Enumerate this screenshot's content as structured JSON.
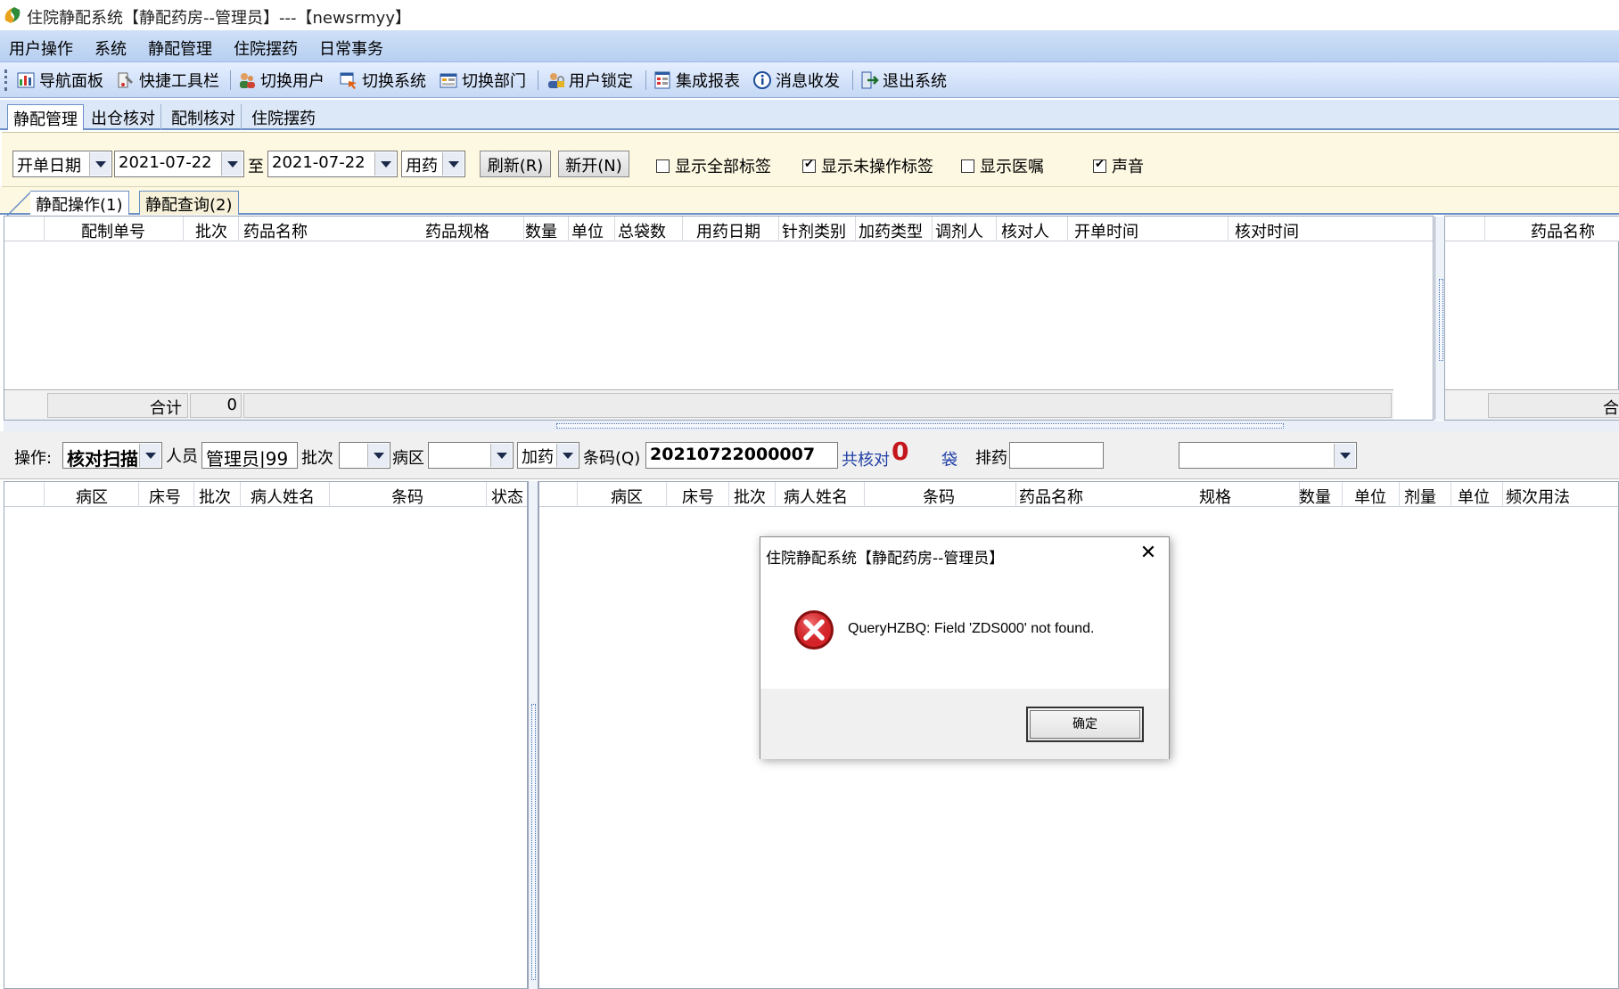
{
  "window": {
    "title": "住院静配系统【静配药房--管理员】---【newsrmyy】"
  },
  "menu": [
    "用户操作",
    "系统",
    "静配管理",
    "住院摆药",
    "日常事务"
  ],
  "toolbar": [
    {
      "label": "导航面板",
      "icon": "dashboard-icon"
    },
    {
      "label": "快捷工具栏",
      "icon": "tools-icon"
    },
    {
      "label": "切换用户",
      "icon": "users-icon"
    },
    {
      "label": "切换系统",
      "icon": "switch-system-icon"
    },
    {
      "label": "切换部门",
      "icon": "department-icon"
    },
    {
      "label": "用户锁定",
      "icon": "user-lock-icon"
    },
    {
      "label": "集成报表",
      "icon": "report-icon"
    },
    {
      "label": "消息收发",
      "icon": "info-icon"
    },
    {
      "label": "退出系统",
      "icon": "exit-icon"
    }
  ],
  "module_tabs": [
    "静配管理",
    "出仓核对",
    "配制核对",
    "住院摆药"
  ],
  "filter": {
    "date_type": "开单日期",
    "date_from": "2021-07-22",
    "to_label": "至",
    "date_to": "2021-07-22",
    "med_type": "用药",
    "refresh": "刷新(R)",
    "new_open": "新开(N)",
    "checks": [
      {
        "label": "显示全部标签",
        "checked": false
      },
      {
        "label": "显示未操作标签",
        "checked": true
      },
      {
        "label": "显示医嘱",
        "checked": false
      },
      {
        "label": "声音",
        "checked": true
      }
    ]
  },
  "sub_tabs": [
    "静配操作(1)",
    "静配查询(2)"
  ],
  "top_grid": {
    "columns": [
      "配制单号",
      "批次",
      "药品名称",
      "药品规格",
      "数量",
      "单位",
      "总袋数",
      "用药日期",
      "针剂类别",
      "加药类型",
      "调剂人",
      "核对人",
      "开单时间",
      "核对时间"
    ],
    "total_label": "合计",
    "total_value": "0"
  },
  "right_grid": {
    "columns": [
      "药品名称"
    ],
    "total_label": "合"
  },
  "operate": {
    "label": "操作:",
    "mode": "核对扫描",
    "person_label": "人员",
    "person_value": "管理员|99",
    "batch_label": "批次",
    "ward_label": "病区",
    "add_med": "加药",
    "barcode_label": "条码(Q)",
    "barcode_value": "20210722000007",
    "total_checked_label": "共核对",
    "total_checked_count": "0",
    "bag_label": "袋",
    "dispense_label": "排药"
  },
  "left_grid": {
    "columns": [
      "病区",
      "床号",
      "批次",
      "病人姓名",
      "条码",
      "状态"
    ]
  },
  "detail_grid": {
    "columns": [
      "病区",
      "床号",
      "批次",
      "病人姓名",
      "条码",
      "药品名称",
      "规格",
      "数量",
      "单位",
      "剂量",
      "单位",
      "频次用法"
    ]
  },
  "dialog": {
    "title": "住院静配系统【静配药房--管理员】",
    "message": "QueryHZBQ: Field 'ZDS000' not found.",
    "ok": "确定",
    "icon": "error-icon"
  }
}
